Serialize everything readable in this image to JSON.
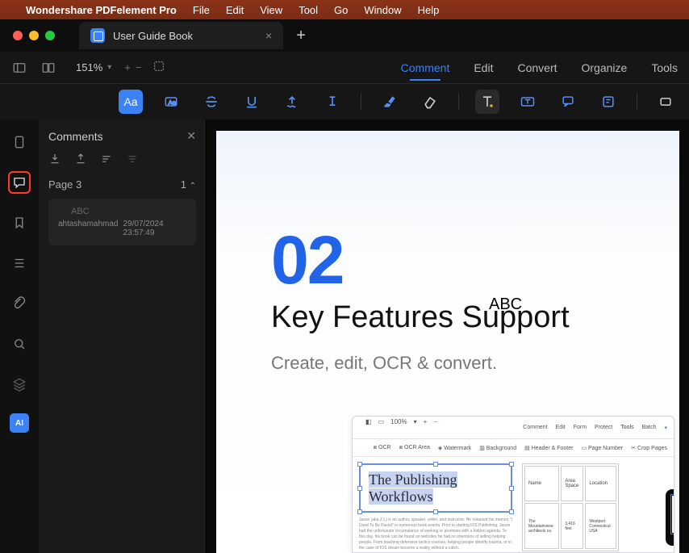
{
  "menubar": {
    "app_name": "Wondershare PDFelement Pro",
    "items": [
      "File",
      "Edit",
      "View",
      "Tool",
      "Go",
      "Window",
      "Help"
    ]
  },
  "tab": {
    "title": "User Guide Book"
  },
  "zoom": {
    "value": "151%"
  },
  "main_tabs": {
    "comment": "Comment",
    "edit": "Edit",
    "convert": "Convert",
    "organize": "Organize",
    "tools": "Tools"
  },
  "tool_labels": {
    "text_style": "Aa"
  },
  "panel": {
    "title": "Comments",
    "page_label": "Page 3",
    "count": "1",
    "comment_text": "ABC",
    "author": "ahtashamahmad",
    "timestamp": "29/07/2024 23:57:49"
  },
  "doc": {
    "number": "02",
    "annotation": "ABC",
    "heading": "Key Features Support",
    "subtext": "Create, edit, OCR & convert."
  },
  "rail": {
    "ai": "AI"
  },
  "mini": {
    "tabs": [
      "Comment",
      "Edit",
      "Form",
      "Protect",
      "Tools",
      "Batch"
    ],
    "row2": [
      "OCR",
      "OCR Area",
      "Watermark",
      "Background",
      "Header & Footer",
      "Page Number",
      "Crop Pages"
    ],
    "zoom": "100%",
    "sel_line1": "The Publishing",
    "sel_line2": "Workflows",
    "table": {
      "h1": "Name",
      "h2": "Area Space",
      "h3": "Location"
    },
    "insert_line1": "The Publishing",
    "insert_line2": "Workflows"
  }
}
